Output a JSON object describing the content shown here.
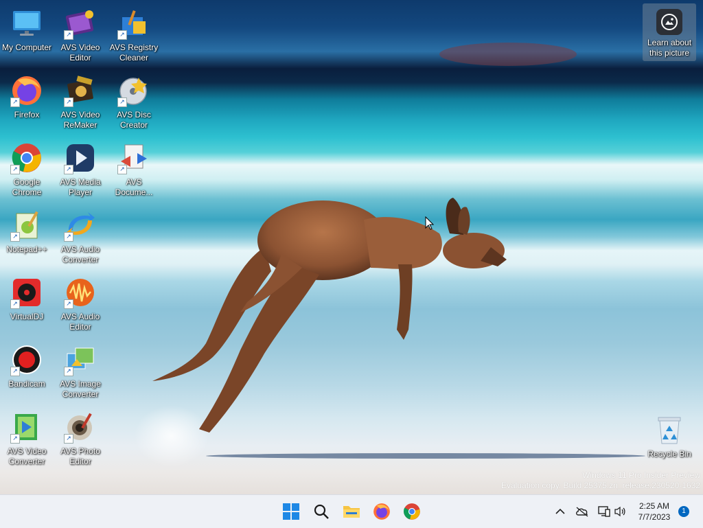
{
  "desktop": {
    "icons": [
      {
        "label": "My Computer",
        "icon": "monitor-icon"
      },
      {
        "label": "AVS Video Editor",
        "icon": "film-clapper-icon"
      },
      {
        "label": "AVS Registry Cleaner",
        "icon": "registry-cleaner-icon"
      },
      {
        "label": "Firefox",
        "icon": "firefox-icon"
      },
      {
        "label": "AVS Video ReMaker",
        "icon": "video-remaker-icon"
      },
      {
        "label": "AVS Disc Creator",
        "icon": "disc-icon"
      },
      {
        "label": "Google Chrome",
        "icon": "chrome-icon"
      },
      {
        "label": "AVS Media Player",
        "icon": "media-player-icon"
      },
      {
        "label": "AVS Docume...",
        "icon": "document-converter-icon"
      },
      {
        "label": "Notepad++",
        "icon": "notepadpp-icon"
      },
      {
        "label": "AVS Audio Converter",
        "icon": "audio-converter-icon"
      },
      {
        "label": "VirtualDJ",
        "icon": "virtualdj-icon"
      },
      {
        "label": "AVS Audio Editor",
        "icon": "audio-editor-icon"
      },
      {
        "label": "Bandicam",
        "icon": "bandicam-icon"
      },
      {
        "label": "AVS Image Converter",
        "icon": "image-converter-icon"
      },
      {
        "label": "AVS Video Converter",
        "icon": "video-converter-icon"
      },
      {
        "label": "AVS Photo Editor",
        "icon": "photo-editor-icon"
      },
      {
        "label": "Recycle Bin",
        "icon": "recycle-bin-icon"
      }
    ],
    "learn_picture": {
      "label": "Learn about this picture",
      "icon": "camera-icon"
    },
    "watermark": {
      "line1": "Windows 11 Pro Insider Preview",
      "line2": "Evaluation copy. Build 25375.zn_release.230520-1632"
    }
  },
  "taskbar": {
    "apps": [
      {
        "name": "Start",
        "icon": "windows-start-icon"
      },
      {
        "name": "Search",
        "icon": "search-icon"
      },
      {
        "name": "File Explorer",
        "icon": "folder-icon"
      },
      {
        "name": "Firefox",
        "icon": "firefox-icon"
      },
      {
        "name": "Google Chrome",
        "icon": "chrome-icon"
      }
    ],
    "tray": {
      "icons": [
        "chevron-up-icon",
        "onedrive-offline-icon",
        "network-icon",
        "volume-icon"
      ],
      "time": "2:25 AM",
      "date": "7/7/2023",
      "notification_count": "1"
    }
  }
}
